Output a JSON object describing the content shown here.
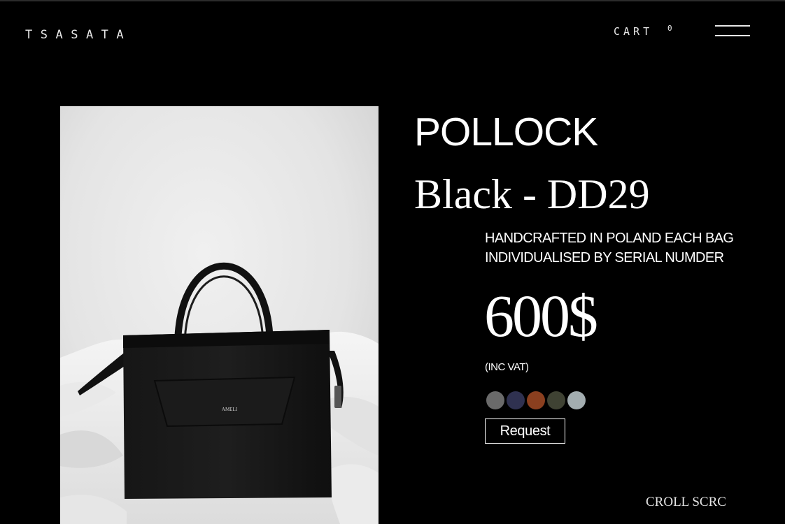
{
  "header": {
    "logo": "TSASATA",
    "cart_label": "CART",
    "cart_count": "0",
    "menu_icon": "hamburger-menu-icon"
  },
  "product": {
    "image_alt": "Black leather handbag on white bedding",
    "image_brand_mark": "AMELI",
    "name": "POLLOCK",
    "variant": "Black - DD29",
    "description": "HANDCRAFTED IN POLAND EACH BAG INDIVIDUALISED BY SERIAL NUMDER",
    "price": "600$",
    "vat_note": "(INC VAT)",
    "swatches": [
      {
        "color": "#6a6a6a"
      },
      {
        "color": "#2f3150"
      },
      {
        "color": "#8a3f1f"
      },
      {
        "color": "#3f4233"
      },
      {
        "color": "#a3adb0"
      }
    ],
    "request_label": "Request"
  },
  "footer": {
    "scroll_label": "CROLL SCRC"
  }
}
